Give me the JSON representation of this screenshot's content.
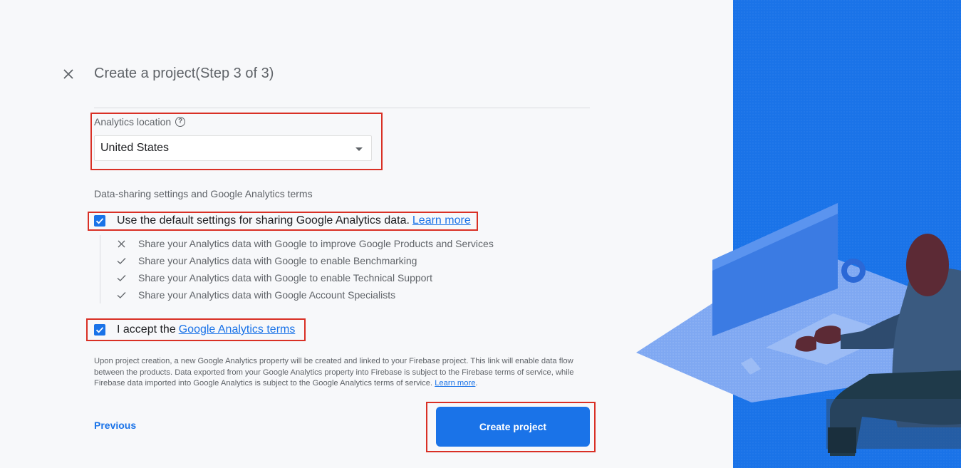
{
  "header": {
    "title": "Create a project(Step 3 of 3)"
  },
  "analytics": {
    "location_label": "Analytics location",
    "help_glyph": "?",
    "location_value": "United States"
  },
  "data_sharing": {
    "heading": "Data-sharing settings and Google Analytics terms",
    "default_settings_label": "Use the default settings for sharing Google Analytics data.",
    "learn_more": "Learn more",
    "items": [
      {
        "label": "Share your Analytics data with Google to improve Google Products and Services",
        "icon": "close-icon"
      },
      {
        "label": "Share your Analytics data with Google to enable Benchmarking",
        "icon": "check-icon"
      },
      {
        "label": "Share your Analytics data with Google to enable Technical Support",
        "icon": "check-icon"
      },
      {
        "label": "Share your Analytics data with Google Account Specialists",
        "icon": "check-icon"
      }
    ]
  },
  "terms": {
    "accept_prefix": "I accept the",
    "terms_link": "Google Analytics terms"
  },
  "disclaimer": {
    "text": "Upon project creation, a new Google Analytics property will be created and linked to your Firebase project. This link will enable data flow between the products. Data exported from your Google Analytics property into Firebase is subject to the Firebase terms of service, while Firebase data imported into Google Analytics is subject to the Google Analytics terms of service.",
    "link": "Learn more",
    "suffix": "."
  },
  "footer": {
    "previous": "Previous",
    "create": "Create project"
  },
  "colors": {
    "accent": "#1a73e8",
    "highlight": "#d93025",
    "panel": "#1a73e8"
  }
}
